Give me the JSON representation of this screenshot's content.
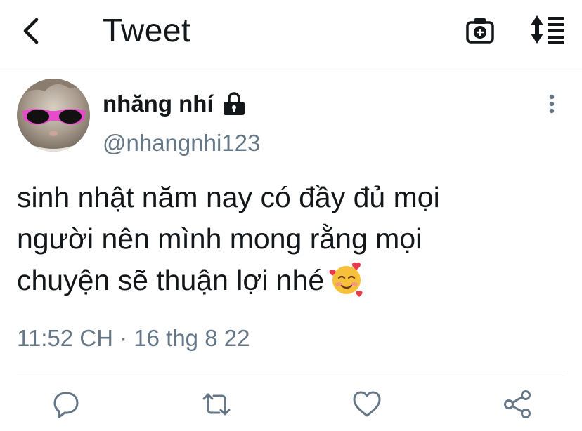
{
  "header": {
    "title": "Tweet",
    "back_icon": "chevron-left-icon",
    "camera_icon": "camera-icon",
    "sort_icon": "sort-arrows-icon"
  },
  "tweet": {
    "display_name": "nhăng nhí",
    "handle": "@nhangnhi123",
    "protected": true,
    "text": "sinh nhật năm nay có đầy đủ mọi\nngười nên mình mong rằng mọi\nchuyện sẽ thuận lợi nhé",
    "emoji": "smiling-face-with-hearts-icon",
    "timestamp": "11:52 CH · 16 thg 8 22"
  },
  "actions": [
    "reply-icon",
    "retweet-icon",
    "like-icon",
    "share-icon"
  ],
  "colors": {
    "text_primary": "#14171a",
    "text_secondary": "#657786",
    "icon_gray": "#657786",
    "divider": "#e1e6ea"
  }
}
